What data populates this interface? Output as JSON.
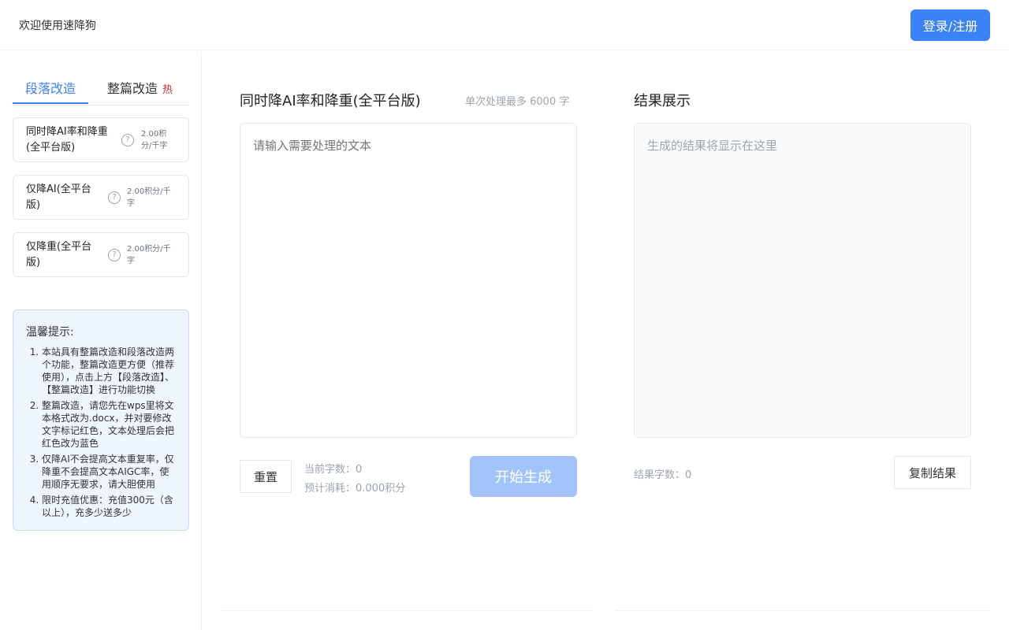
{
  "header": {
    "welcome": "欢迎使用速降狗",
    "login_label": "登录/注册"
  },
  "sidebar": {
    "tabs": [
      {
        "label": "段落改造",
        "active": true
      },
      {
        "label": "整篇改造",
        "badge": "热"
      }
    ],
    "modes": [
      {
        "name_line1": "同时降AI率和降重",
        "name_line2": "(全平台版)",
        "price_line1": "2.00积",
        "price_line2": "分/千字"
      },
      {
        "name_line1": "仅降AI(全平台",
        "name_line2": "版)",
        "price_line1": "2.00积分/千",
        "price_line2": "字"
      },
      {
        "name_line1": "仅降重(全平台",
        "name_line2": "版)",
        "price_line1": "2.00积分/千",
        "price_line2": "字"
      }
    ],
    "help_icon": "?",
    "tips": {
      "title": "温馨提示:",
      "items": [
        "本站具有整篇改造和段落改造两个功能，整篇改造更方便（推荐使用），点击上方【段落改造】、【整篇改造】进行功能切换",
        "整篇改造，请您先在wps里将文本格式改为.docx，并对要修改文字标记红色，文本处理后会把红色改为蓝色",
        "仅降AI不会提高文本重复率，仅降重不会提高文本AIGC率，使用顺序无要求，请大胆使用",
        "限时充值优惠：充值300元（含以上），充多少送多少"
      ]
    }
  },
  "editor": {
    "title": "同时降AI率和降重(全平台版)",
    "limit_text": "单次处理最多 6000 字",
    "input_placeholder": "请输入需要处理的文本",
    "reset_label": "重置",
    "char_count": "当前字数：0",
    "estimated_cost": "预计消耗：0.000积分",
    "generate_label": "开始生成"
  },
  "result": {
    "title": "结果展示",
    "placeholder": "生成的结果将显示在这里",
    "char_count": "结果字数：0",
    "copy_label": "复制结果"
  },
  "colors": {
    "accent": "#3b82f6",
    "accent_disabled": "#a3c4fa",
    "hot": "#dc2626",
    "tips_bg": "#eef5ff"
  }
}
